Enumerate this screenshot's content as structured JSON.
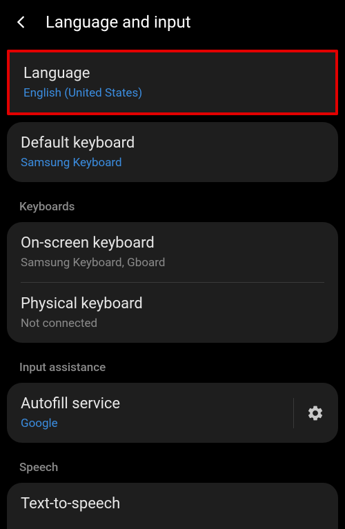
{
  "header": {
    "title": "Language and input"
  },
  "language": {
    "title": "Language",
    "subtitle": "English (United States)"
  },
  "defaultKeyboard": {
    "title": "Default keyboard",
    "subtitle": "Samsung Keyboard"
  },
  "sections": {
    "keyboards": "Keyboards",
    "inputAssistance": "Input assistance",
    "speech": "Speech"
  },
  "onScreenKeyboard": {
    "title": "On-screen keyboard",
    "subtitle": "Samsung Keyboard, Gboard"
  },
  "physicalKeyboard": {
    "title": "Physical keyboard",
    "subtitle": "Not connected"
  },
  "autofill": {
    "title": "Autofill service",
    "subtitle": "Google"
  },
  "textToSpeech": {
    "title": "Text-to-speech"
  }
}
